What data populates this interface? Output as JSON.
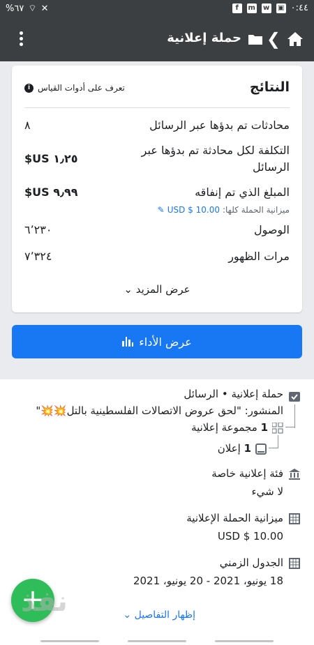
{
  "status_bar": {
    "time": "٠:٤٤",
    "battery": "%٦٧"
  },
  "app_bar": {
    "title": "حملة إعلانية"
  },
  "results": {
    "title": "النتائج",
    "learn": "تعرف على أدوات القياس",
    "rows": [
      {
        "label": "محادثات تم بدؤها عبر الرسائل",
        "value": "٨"
      },
      {
        "label": "التكلفة لكل محادثة تم بدؤها عبر الرسائل",
        "value": "١٫٢٥ US$"
      },
      {
        "label": "المبلغ الذي تم إنفاقه",
        "value": "٩٫٩٩ US$",
        "sub_label": "ميزانية الحملة كلها:",
        "sub_value": "10.00 $ USD"
      },
      {
        "label": "الوصول",
        "value": "٦٬٢٣٠"
      },
      {
        "label": "مرات الظهور",
        "value": "٧٬٣٢٤"
      }
    ],
    "more": "عرض المزيد"
  },
  "performance_button": "عرض الأداء",
  "details": {
    "campaign": "حملة إعلانية • الرسائل",
    "post": "المنشور: \"لحق عروض الاتصالات الفلسطينية بالتل💥💥\"",
    "adset_count": "1",
    "adset_label": "مجموعة إعلانية",
    "ad_count": "1",
    "ad_label": "إعلان",
    "category_label": "فئة إعلانية خاصة",
    "category_value": "لا شيء",
    "budget_label": "ميزانية الحملة الإعلانية",
    "budget_value": "10.00 $ USD",
    "schedule_label": "الجدول الزمني",
    "schedule_value": "18 يونيو، 2021 - 20 يونيو، 2021",
    "show_details": "إظهار التفاصيل"
  },
  "watermark": "نفذ",
  "colors": {
    "accent": "#1877f2",
    "fab": "#2ebd59",
    "appbar": "#3c3f41"
  }
}
